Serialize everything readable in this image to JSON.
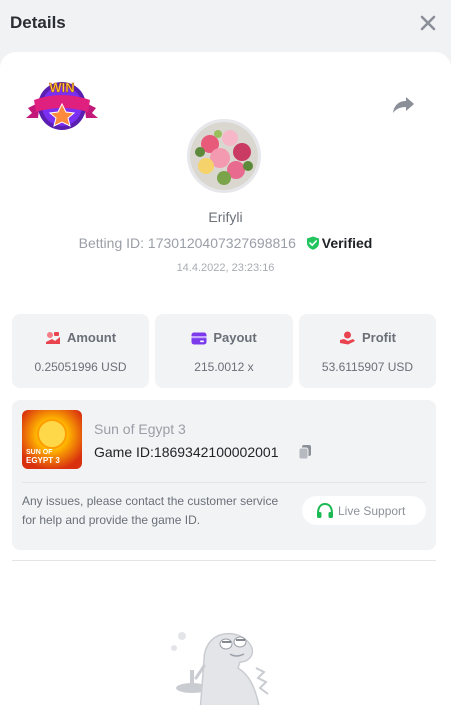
{
  "header": {
    "title": "Details",
    "close_icon": "close-icon"
  },
  "player": {
    "name": "Erifyli",
    "betting_id_label": "Betting ID:",
    "betting_id": "1730120407327698816",
    "verified_label": "Verified",
    "timestamp": "14.4.2022, 23:23:16"
  },
  "badge": {
    "text": "WIN"
  },
  "stats": [
    {
      "label": "Amount",
      "value": "0.25051996 USD",
      "icon": "amount-icon"
    },
    {
      "label": "Payout",
      "value": "215.0012 x",
      "icon": "payout-card-icon"
    },
    {
      "label": "Profit",
      "value": "53.6115907 USD",
      "icon": "profit-hand-icon"
    }
  ],
  "game": {
    "name": "Sun of Egypt 3",
    "id_label": "Game ID:",
    "id": "1869342100002001",
    "thumb_text_1": "SUN OF",
    "thumb_text_2": "EGYPT 3"
  },
  "support": {
    "notice": "Any issues, please contact the customer service for help and provide the game ID.",
    "button_label": "Live Support"
  },
  "colors": {
    "accent_green": "#1db954",
    "verified_green": "#22c55e",
    "stat_red": "#e8434f",
    "payout_purple": "#7c3aed"
  }
}
